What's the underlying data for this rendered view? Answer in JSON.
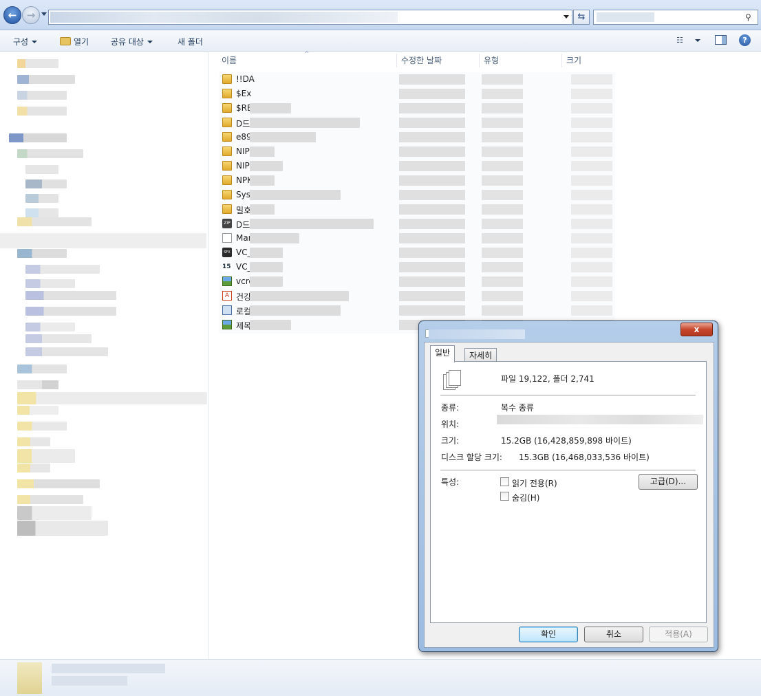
{
  "toolbar": {
    "organize": "구성",
    "open": "열기",
    "share_with": "공유 대상",
    "new_folder": "새 폴더"
  },
  "columns": {
    "name": "이름",
    "date_modified": "수정한 날짜",
    "type": "유형",
    "size": "크기"
  },
  "files": [
    {
      "name": "!!DA",
      "icon": "folder-icon"
    },
    {
      "name": "$Ex",
      "icon": "folder-icon"
    },
    {
      "name": "$RE",
      "icon": "folder-icon"
    },
    {
      "name": "D드",
      "icon": "folder-icon"
    },
    {
      "name": "e89",
      "icon": "folder-icon"
    },
    {
      "name": "NIP",
      "icon": "folder-icon"
    },
    {
      "name": "NIP",
      "icon": "folder-icon"
    },
    {
      "name": "NPK",
      "icon": "folder-icon"
    },
    {
      "name": "Syst",
      "icon": "folder-icon"
    },
    {
      "name": "밀호",
      "icon": "folder-icon"
    },
    {
      "name": "D드",
      "icon": "zip-icon"
    },
    {
      "name": "Mar",
      "icon": "document-icon"
    },
    {
      "name": "VC_",
      "icon": "installer-icon"
    },
    {
      "name": "VC_",
      "icon": "setup-icon"
    },
    {
      "name": "vcre",
      "icon": "image-icon"
    },
    {
      "name": "건강",
      "icon": "pdf-icon"
    },
    {
      "name": "로컬",
      "icon": "shortcut-icon"
    },
    {
      "name": "제목",
      "icon": "image-icon"
    }
  ],
  "dialog": {
    "close_label": "x",
    "tabs": [
      "일반",
      "자세히"
    ],
    "summary": "파일 19,122, 폴더 2,741",
    "type_label": "종류:",
    "type_value": "복수 종류",
    "location_label": "위치:",
    "size_label": "크기:",
    "size_value": "15.2GB (16,428,859,898 바이트)",
    "disk_size_label": "디스크 할당 크기:",
    "disk_size_value": "15.3GB (16,468,033,536 바이트)",
    "attributes_label": "특성:",
    "readonly_label": "읽기 전용(R)",
    "hidden_label": "숨김(H)",
    "advanced_button": "고급(D)...",
    "ok_button": "확인",
    "cancel_button": "취소",
    "apply_button": "적용(A)"
  }
}
